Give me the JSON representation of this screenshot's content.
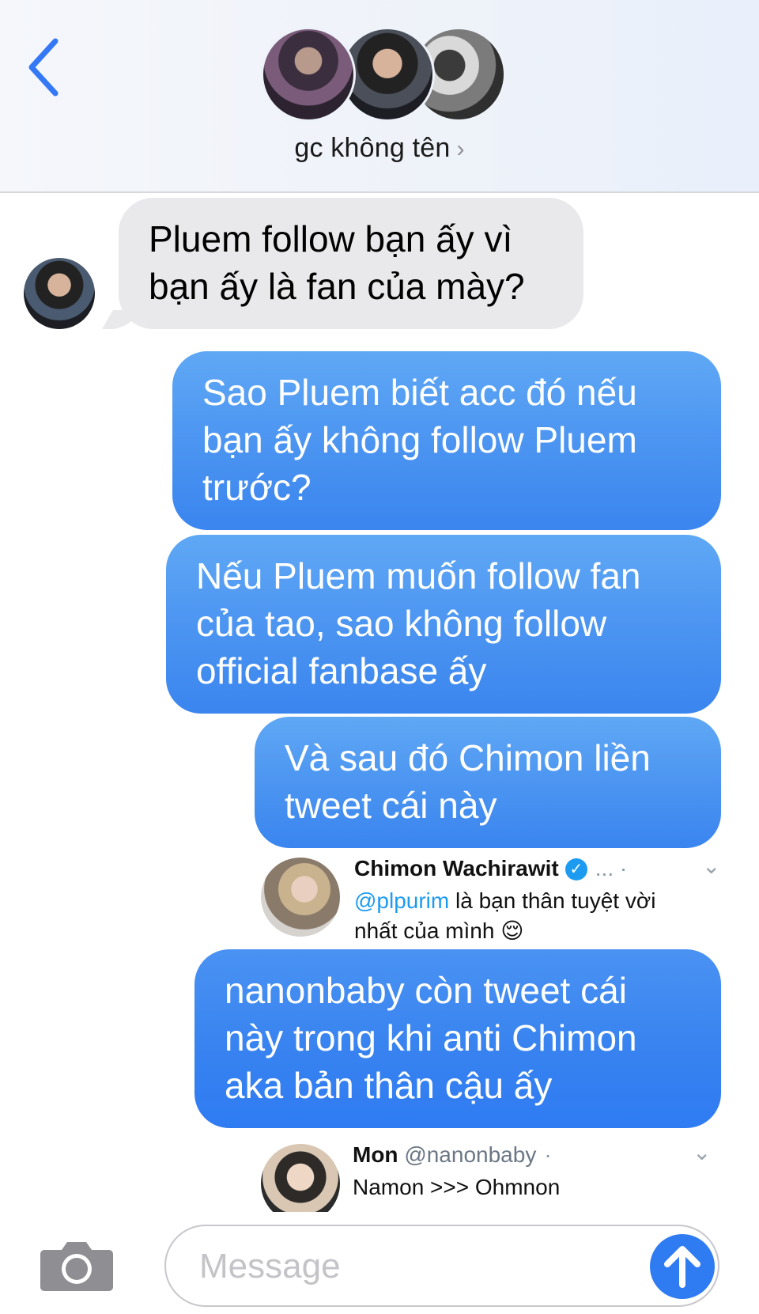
{
  "header": {
    "group_name": "gc không tên",
    "chevron": "›",
    "back_icon": "chevron-left-icon"
  },
  "colors": {
    "accent": "#2f7bf2",
    "outgoing_bubble": "#4c95f1",
    "incoming_bubble": "#e9e9eb"
  },
  "messages": [
    {
      "direction": "incoming",
      "text": "Pluem follow bạn ấy vì bạn ấy là fan của mày?"
    },
    {
      "direction": "outgoing",
      "text": "Sao Pluem biết acc đó nếu bạn ấy không follow Pluem trước?"
    },
    {
      "direction": "outgoing",
      "text": "Nếu Pluem muốn follow fan của tao, sao không follow official fanbase ấy"
    },
    {
      "direction": "outgoing",
      "text": "Và sau đó Chimon liền tweet cái này"
    },
    {
      "direction": "outgoing",
      "text": "nanonbaby còn tweet cái này trong khi anti Chimon aka bản thân cậu ấy"
    }
  ],
  "tweets": [
    {
      "name": "Chimon Wachirawit",
      "verified": "✓",
      "dots": "... ·",
      "mention": "@plpurim",
      "text_line1": " là bạn thân tuyệt vời",
      "text_line2": "nhất của mình 😌"
    },
    {
      "name": "Mon",
      "handle": "@nanonbaby",
      "dots": "·",
      "text": "Namon >>> Ohmnon"
    }
  ],
  "composer": {
    "placeholder": "Message",
    "value": "",
    "camera_icon": "camera-icon",
    "send_icon": "arrow-up-icon"
  }
}
